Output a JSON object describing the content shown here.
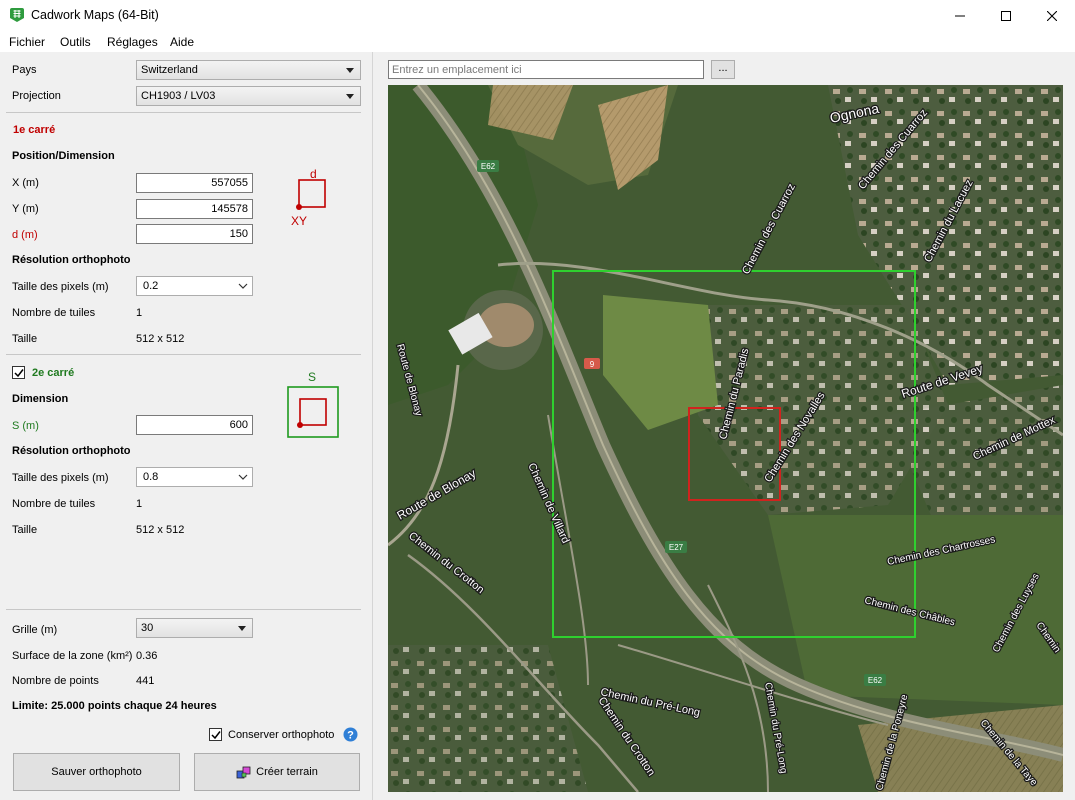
{
  "window": {
    "title": "Cadwork Maps (64-Bit)"
  },
  "menu": [
    "Fichier",
    "Outils",
    "Réglages",
    "Aide"
  ],
  "country": {
    "label": "Pays",
    "value": "Switzerland"
  },
  "projection": {
    "label": "Projection",
    "value": "CH1903 / LV03"
  },
  "square1": {
    "heading": "1e carré",
    "position_heading": "Position/Dimension",
    "x_label": "X (m)",
    "x_value": "557055",
    "y_label": "Y (m)",
    "y_value": "145578",
    "d_label": "d (m)",
    "d_value": "150",
    "diagram_d": "d",
    "diagram_xy": "XY",
    "resolution_heading": "Résolution orthophoto",
    "pixel_size_label": "Taille des pixels (m)",
    "pixel_size_value": "0.2",
    "tiles_label": "Nombre de tuiles",
    "tiles_value": "1",
    "size_label": "Taille",
    "size_value": "512 x 512"
  },
  "square2": {
    "enabled": true,
    "heading": "2e carré",
    "dimension_heading": "Dimension",
    "s_label": "S (m)",
    "s_value": "600",
    "diagram_s": "S",
    "resolution_heading": "Résolution orthophoto",
    "pixel_size_label": "Taille des pixels (m)",
    "pixel_size_value": "0.8",
    "tiles_label": "Nombre de tuiles",
    "tiles_value": "1",
    "size_label": "Taille",
    "size_value": "512 x 512"
  },
  "grid": {
    "label": "Grille (m)",
    "value": "30",
    "area_label": "Surface de la zone (km²)",
    "area_value": "0.36",
    "points_label": "Nombre de points",
    "points_value": "441",
    "limit_text": "Limite: 25.000 points chaque 24 heures"
  },
  "keep_orthophoto": {
    "label": "Conserver orthophoto",
    "checked": true
  },
  "buttons": {
    "save": "Sauver orthophoto",
    "create": "Créer terrain"
  },
  "search": {
    "placeholder": "Entrez un emplacement ici",
    "browse": "..."
  },
  "map_labels": {
    "ognona": "Ognona",
    "e62": "E62",
    "e27": "E27",
    "route9": "9",
    "cuarroz1": "Chemin des Cuarroz",
    "cuarroz2": "Chemin des Cuarroz",
    "lacuez": "Chemin du Lacuez",
    "paradis": "Chemin du Paradis",
    "novalles": "Chemin des Novalles",
    "vevey": "Route de Vevey",
    "mottex": "Chemin de Mottex",
    "blonay1": "Route de Blonay",
    "blonay2": "Route de Blonay",
    "villard": "Chemin de Villard",
    "crotton1": "Chemin du Crotton",
    "crotton2": "Chemin du Crotton",
    "prelong": "Chemin du Pré-Long",
    "chartrosses": "Chemin des Chartrosses",
    "chables": "Chemin des Châbles",
    "luyses": "Chemin des Luyses",
    "prelong2": "Chemin du Pré-Long",
    "poneyre": "Chemin de la Poneyre",
    "taye": "Chemin de la Taye",
    "chemin_right": "Chemin"
  },
  "colors": {
    "square1": "#d0231e",
    "square2": "#2fd02f"
  }
}
